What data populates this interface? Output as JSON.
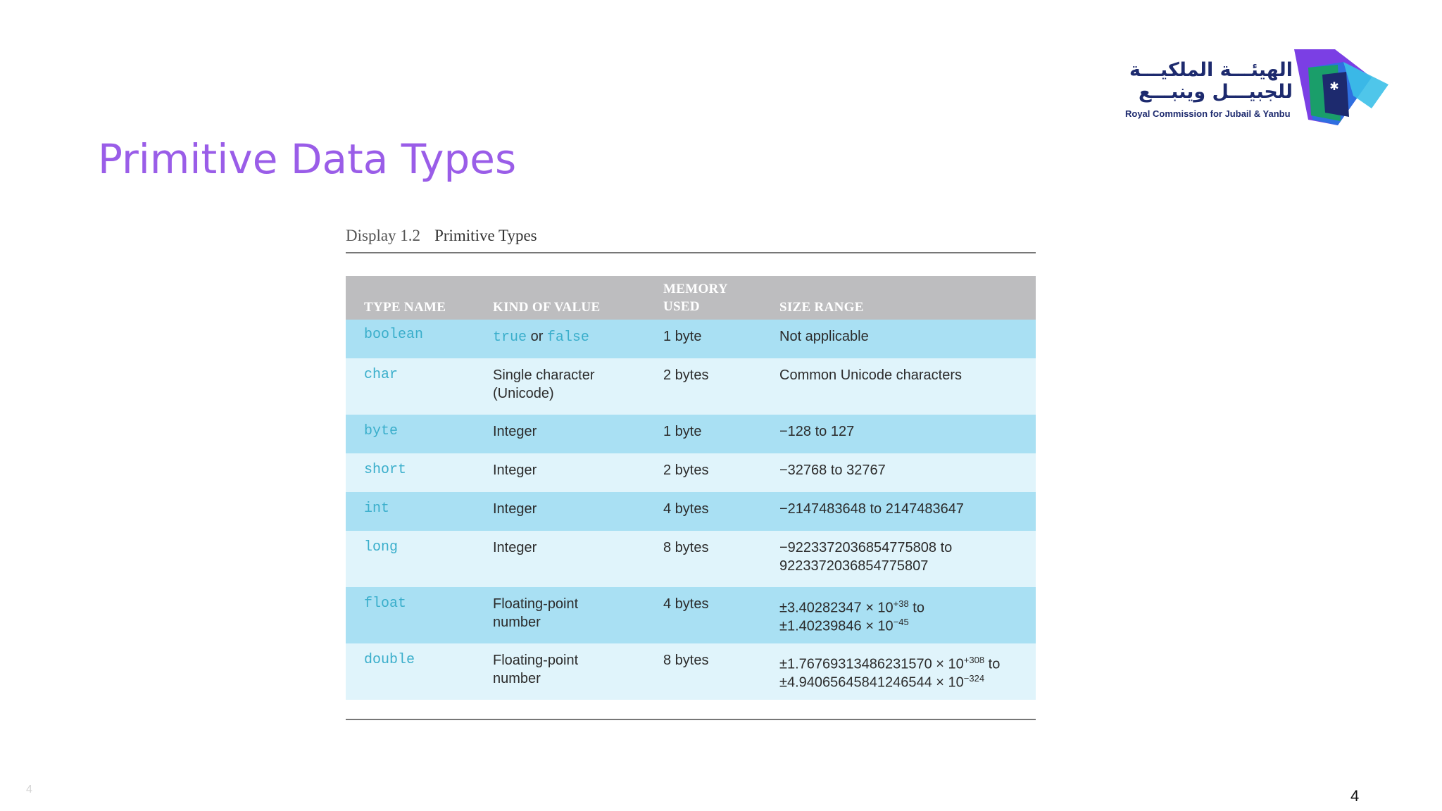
{
  "slide": {
    "title": "Primitive Data Types",
    "page_number": "4",
    "corner_number": "4"
  },
  "logo": {
    "arabic_line1": "الهيئـــة الملكيـــة",
    "arabic_line2": "للجبيـــل وينبـــع",
    "english": "Royal Commission for Jubail & Yanbu",
    "colors": [
      "#7b3fe4",
      "#2f6fe0",
      "#3cc0e8",
      "#1a9e6a",
      "#1d2a6e"
    ]
  },
  "display": {
    "number": "Display 1.2",
    "name": "Primitive Types"
  },
  "table": {
    "headers": {
      "type_name": "TYPE NAME",
      "kind_of_value": "KIND OF VALUE",
      "memory_used_1": "MEMORY",
      "memory_used_2": "USED",
      "size_range": "SIZE RANGE"
    },
    "boolean": {
      "type": "boolean",
      "kind_true": "true",
      "kind_or": " or ",
      "kind_false": "false",
      "memory": "1 byte",
      "range": "Not applicable"
    },
    "char": {
      "type": "char",
      "kind1": "Single character",
      "kind2": "(Unicode)",
      "memory": "2 bytes",
      "range": "Common Unicode characters"
    },
    "byte": {
      "type": "byte",
      "kind": "Integer",
      "memory": "1 byte",
      "range": "−128 to 127"
    },
    "short": {
      "type": "short",
      "kind": "Integer",
      "memory": "2 bytes",
      "range": "−32768 to 32767"
    },
    "int": {
      "type": "int",
      "kind": "Integer",
      "memory": "4 bytes",
      "range": "−2147483648 to 2147483647"
    },
    "long": {
      "type": "long",
      "kind": "Integer",
      "memory": "8 bytes",
      "range1": "−9223372036854775808 to",
      "range2": "9223372036854775807"
    },
    "float": {
      "type": "float",
      "kind1": "Floating-point",
      "kind2": "number",
      "memory": "4 bytes",
      "r1_base": "±3.40282347 × 10",
      "r1_exp": "+38",
      "r1_tail": " to",
      "r2_base": "±1.40239846 × 10",
      "r2_exp": "−45"
    },
    "double": {
      "type": "double",
      "kind1": "Floating-point",
      "kind2": "number",
      "memory": "8 bytes",
      "r1_base": "±1.76769313486231570 × 10",
      "r1_exp": "+308",
      "r1_tail": " to",
      "r2_base": "±4.94065645841246544 × 10",
      "r2_exp": "−324"
    }
  }
}
